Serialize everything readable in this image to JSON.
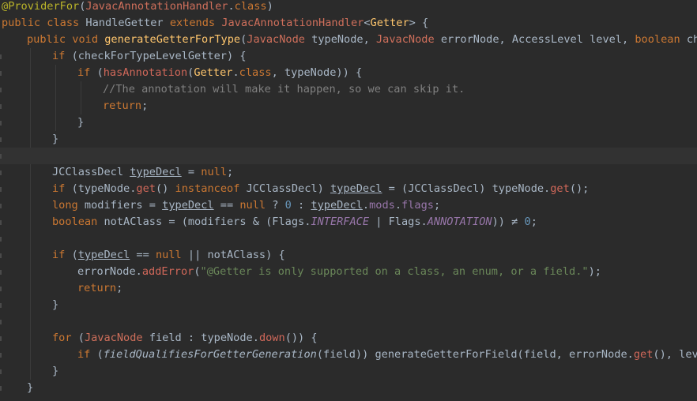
{
  "editor": {
    "lines": [
      {
        "indent": 0,
        "tokens": [
          [
            "anno",
            "@"
          ],
          [
            "anno",
            "ProviderFor"
          ],
          [
            "plain",
            "("
          ],
          [
            "type",
            "JavacAnnotationHandler"
          ],
          [
            "plain",
            "."
          ],
          [
            "kw",
            "class"
          ],
          [
            "plain",
            ")"
          ]
        ]
      },
      {
        "indent": 0,
        "tokens": [
          [
            "kw",
            "public class "
          ],
          [
            "plain",
            "HandleGetter "
          ],
          [
            "kw",
            "extends "
          ],
          [
            "type",
            "JavacAnnotationHandler"
          ],
          [
            "plain",
            "<"
          ],
          [
            "method",
            "Getter"
          ],
          [
            "plain",
            "> {"
          ]
        ]
      },
      {
        "indent": 1,
        "tokens": [
          [
            "kw",
            "public void "
          ],
          [
            "method",
            "generateGetterForType"
          ],
          [
            "plain",
            "("
          ],
          [
            "type",
            "JavacNode"
          ],
          [
            "plain",
            " typeNode, "
          ],
          [
            "type",
            "JavacNode"
          ],
          [
            "plain",
            " errorNode, AccessLevel level, "
          ],
          [
            "kw",
            "boolean "
          ],
          [
            "plain",
            "checkForTypeLevelGetter) {"
          ]
        ]
      },
      {
        "indent": 2,
        "tokens": [
          [
            "kw",
            "if "
          ],
          [
            "plain",
            "(checkForTypeLevelGetter) {"
          ]
        ]
      },
      {
        "indent": 3,
        "tokens": [
          [
            "kw",
            "if "
          ],
          [
            "plain",
            "("
          ],
          [
            "call",
            "hasAnnotation"
          ],
          [
            "plain",
            "("
          ],
          [
            "method",
            "Getter"
          ],
          [
            "plain",
            "."
          ],
          [
            "kw",
            "class"
          ],
          [
            "plain",
            ", typeNode)) {"
          ]
        ]
      },
      {
        "indent": 4,
        "tokens": [
          [
            "comment",
            "//The annotation will make it happen, so we can skip it."
          ]
        ]
      },
      {
        "indent": 4,
        "tokens": [
          [
            "kw",
            "return"
          ],
          [
            "plain",
            ";"
          ]
        ]
      },
      {
        "indent": 3,
        "tokens": [
          [
            "plain",
            "}"
          ]
        ]
      },
      {
        "indent": 2,
        "tokens": [
          [
            "plain",
            "}"
          ]
        ]
      },
      {
        "indent": 0,
        "tokens": [],
        "current": true
      },
      {
        "indent": 2,
        "tokens": [
          [
            "plain",
            "JCClassDecl "
          ],
          [
            "var",
            "typeDecl"
          ],
          [
            "plain",
            " = "
          ],
          [
            "kw",
            "null"
          ],
          [
            "plain",
            ";"
          ]
        ]
      },
      {
        "indent": 2,
        "tokens": [
          [
            "kw",
            "if "
          ],
          [
            "plain",
            "(typeNode."
          ],
          [
            "call",
            "get"
          ],
          [
            "plain",
            "() "
          ],
          [
            "kw",
            "instanceof "
          ],
          [
            "plain",
            "JCClassDecl) "
          ],
          [
            "var",
            "typeDecl"
          ],
          [
            "plain",
            " = (JCClassDecl) typeNode."
          ],
          [
            "call",
            "get"
          ],
          [
            "plain",
            "();"
          ]
        ]
      },
      {
        "indent": 2,
        "tokens": [
          [
            "kw",
            "long "
          ],
          [
            "plain",
            "modifiers = "
          ],
          [
            "var",
            "typeDecl"
          ],
          [
            "plain",
            " == "
          ],
          [
            "kw",
            "null "
          ],
          [
            "plain",
            "? "
          ],
          [
            "number",
            "0"
          ],
          [
            "plain",
            " : "
          ],
          [
            "var",
            "typeDecl"
          ],
          [
            "plain",
            "."
          ],
          [
            "field",
            "mods"
          ],
          [
            "plain",
            "."
          ],
          [
            "field",
            "flags"
          ],
          [
            "plain",
            ";"
          ]
        ]
      },
      {
        "indent": 2,
        "tokens": [
          [
            "kw",
            "boolean "
          ],
          [
            "plain",
            "notAClass = (modifiers & (Flags."
          ],
          [
            "static",
            "INTERFACE"
          ],
          [
            "plain",
            " | Flags."
          ],
          [
            "static",
            "ANNOTATION"
          ],
          [
            "plain",
            ")) ≠ "
          ],
          [
            "number",
            "0"
          ],
          [
            "plain",
            ";"
          ]
        ]
      },
      {
        "indent": 0,
        "tokens": []
      },
      {
        "indent": 2,
        "tokens": [
          [
            "kw",
            "if "
          ],
          [
            "plain",
            "("
          ],
          [
            "var",
            "typeDecl"
          ],
          [
            "plain",
            " == "
          ],
          [
            "kw",
            "null "
          ],
          [
            "plain",
            "|| notAClass) {"
          ]
        ]
      },
      {
        "indent": 3,
        "tokens": [
          [
            "plain",
            "errorNode."
          ],
          [
            "call",
            "addError"
          ],
          [
            "plain",
            "("
          ],
          [
            "string",
            "\"@Getter is only supported on a class, an enum, or a field.\""
          ],
          [
            "plain",
            ");"
          ]
        ]
      },
      {
        "indent": 3,
        "tokens": [
          [
            "kw",
            "return"
          ],
          [
            "plain",
            ";"
          ]
        ]
      },
      {
        "indent": 2,
        "tokens": [
          [
            "plain",
            "}"
          ]
        ]
      },
      {
        "indent": 0,
        "tokens": []
      },
      {
        "indent": 2,
        "tokens": [
          [
            "kw",
            "for "
          ],
          [
            "plain",
            "("
          ],
          [
            "type",
            "JavacNode"
          ],
          [
            "plain",
            " field : typeNode."
          ],
          [
            "call",
            "down"
          ],
          [
            "plain",
            "()) {"
          ]
        ]
      },
      {
        "indent": 3,
        "tokens": [
          [
            "kw",
            "if "
          ],
          [
            "plain",
            "("
          ],
          [
            "italic",
            "fieldQualifiesForGetterGeneration"
          ],
          [
            "plain",
            "(field)) generateGetterForField(field, errorNode."
          ],
          [
            "call",
            "get"
          ],
          [
            "plain",
            "(), level, "
          ],
          [
            "kw",
            "false"
          ],
          [
            "plain",
            ");"
          ]
        ]
      },
      {
        "indent": 2,
        "tokens": [
          [
            "plain",
            "}"
          ]
        ]
      },
      {
        "indent": 1,
        "tokens": [
          [
            "plain",
            "}"
          ]
        ]
      }
    ]
  }
}
